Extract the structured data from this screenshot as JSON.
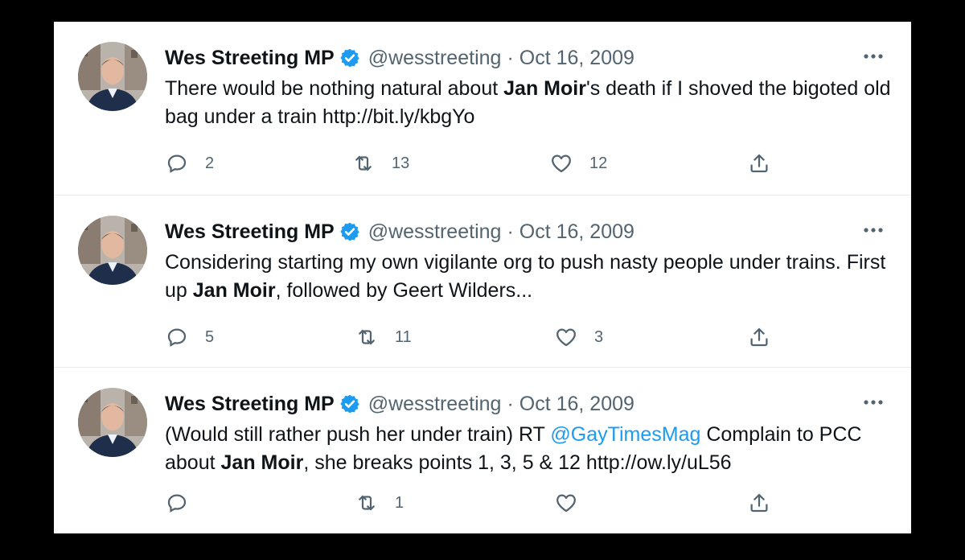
{
  "colors": {
    "accent": "#1d9bf0",
    "text": "#0f1419",
    "muted": "#536471"
  },
  "tweets": [
    {
      "name": "Wes Streeting MP",
      "handle": "@wesstreeting",
      "separator": "·",
      "date": "Oct 16, 2009",
      "text_parts": [
        "There would be nothing natural about ",
        "Jan Moir",
        "'s death if I shoved the bigoted old bag under a train http://bit.ly/kbgYo"
      ],
      "replies": "2",
      "retweets": "13",
      "likes": "12"
    },
    {
      "name": "Wes Streeting MP",
      "handle": "@wesstreeting",
      "separator": "·",
      "date": "Oct 16, 2009",
      "text_parts": [
        "Considering starting my own vigilante org to push nasty people under trains. First up ",
        "Jan Moir",
        ", followed by Geert Wilders..."
      ],
      "replies": "5",
      "retweets": "11",
      "likes": "3"
    },
    {
      "name": "Wes Streeting MP",
      "handle": "@wesstreeting",
      "separator": "·",
      "date": "Oct 16, 2009",
      "text_parts": [
        "(Would still rather push her under train) RT ",
        "@GayTimesMag",
        " Complain to PCC about ",
        "Jan Moir",
        ", she breaks points 1, 3, 5 & 12 http://ow.ly/uL56"
      ],
      "replies": "",
      "retweets": "1",
      "likes": ""
    }
  ],
  "icons": {
    "verified": "verified-badge-icon",
    "more": "more-options-icon",
    "reply": "reply-icon",
    "retweet": "retweet-icon",
    "like": "heart-icon",
    "share": "share-icon"
  }
}
